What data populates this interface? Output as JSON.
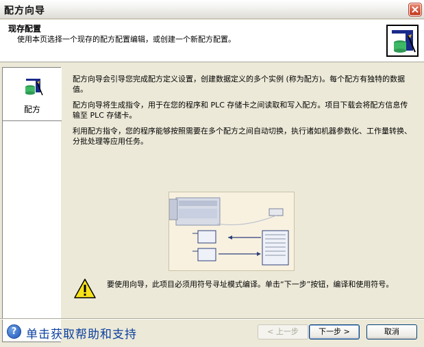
{
  "window": {
    "title": "配方向导"
  },
  "header": {
    "title": "现存配置",
    "description": "使用本页选择一个现存的配方配置编辑，或创建一个新配方配置。"
  },
  "sidebar": {
    "items": [
      {
        "label": "配方",
        "icon": "recipe-icon"
      }
    ]
  },
  "main": {
    "paragraphs": [
      "配方向导会引导您完成配方定义设置，创建数据定义的多个实例 (称为配方)。每个配方有独特的数据值。",
      "配方向导将生成指令，用于在您的程序和 PLC 存储卡之间读取和写入配方。项目下载会将配方信息传输至 PLC 存储卡。",
      "利用配方指令，您的程序能够按照需要在多个配方之间自动切换，执行诸如机器参数化、工作量转换、分批处理等应用任务。"
    ],
    "warning": "要使用向导，此项目必须用符号寻址模式编译。单击“下一步”按钮，编译和使用符号。"
  },
  "footer": {
    "help_label": "单击获取帮助和支持",
    "prev_label": "< 上一步",
    "next_label": "下一步 >",
    "cancel_label": "取消"
  }
}
